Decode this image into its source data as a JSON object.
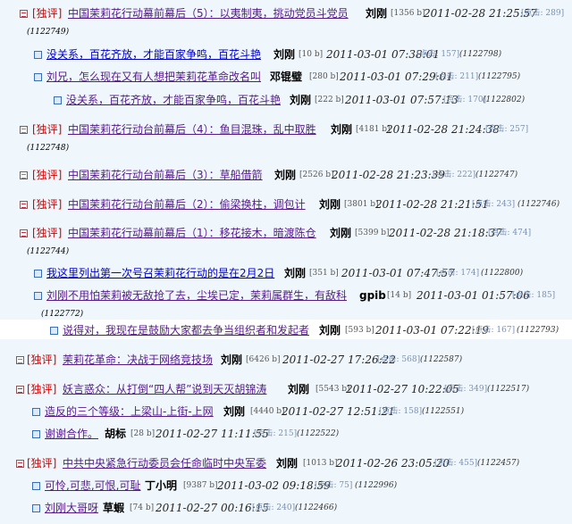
{
  "posts": [
    {
      "tag": "[独评]",
      "title": "中国茉莉花行动幕前幕后（5）：以夷制夷，挑动党员斗党员",
      "author": "刘刚",
      "size": "[1356 b]",
      "date": "2011-02-28 21:25:57",
      "clicks": "[点击: 289]",
      "id": "(1122749)"
    },
    {
      "title": "没关系，百花齐放，才能百家争鸣，百花斗艳",
      "author": "刘刚",
      "size": "[10 b]",
      "date": "2011-03-01 07:38:01",
      "clicks": "[点击: 157]",
      "id": "(1122798)"
    },
    {
      "title": "刘兄，怎么现在又有人想把茉莉花革命改名叫",
      "author": "邓锟璧",
      "size": "[280 b]",
      "date": "2011-03-01 07:29:01",
      "clicks": "[点击: 211]",
      "id": "(1122795)"
    },
    {
      "title": "没关系，百花齐放，才能百家争鸣，百花斗艳",
      "author": "刘刚",
      "size": "[222 b]",
      "date": "2011-03-01 07:57:13",
      "clicks": "[点击: 170]",
      "id": "(1122802)"
    },
    {
      "tag": "[独评]",
      "title": "中国茉莉花行动台前幕后（4）：鱼目混珠，乱中取胜",
      "author": "刘刚",
      "size": "[4181 b]",
      "date": "2011-02-28 21:24:38",
      "clicks": "[点击: 257]",
      "id": "(1122748)"
    },
    {
      "tag": "[独评]",
      "title": "中国茉莉花行动台前幕后（3）：草船借箭",
      "author": "刘刚",
      "size": "[2526 b]",
      "date": "2011-02-28 21:23:39",
      "clicks": "[点击: 222]",
      "id": "(1122747)"
    },
    {
      "tag": "[独评]",
      "title": "中国茉莉花行动台前幕后（2）：偷梁换柱，调包计",
      "author": "刘刚",
      "size": "[3801 b]",
      "date": "2011-02-28 21:21:51",
      "clicks": "[点击: 243]",
      "id": "(1122746)"
    },
    {
      "tag": "[独评]",
      "title": "中国茉莉花行动幕前幕后（1）：移花接木，暗渡陈仓",
      "author": "刘刚",
      "size": "[5399 b]",
      "date": "2011-02-28 21:18:37",
      "clicks": "[点击: 474]",
      "id": "(1122744)"
    },
    {
      "title": "我这里列出第一次号召茉莉花行动的是在2月2日",
      "author": "刘刚",
      "size": "[351 b]",
      "date": "2011-03-01 07:47:57",
      "clicks": "[点击: 174]",
      "id": "(1122800)"
    },
    {
      "title": "刘刚不用怕茉莉被无敌抢了去，尘埃已定，茉莉属群生，有敌科",
      "author": "gpib",
      "size": "[14 b]",
      "date": "2011-03-01 01:57:06",
      "clicks": "[点击: 185]",
      "id": "(1122772)"
    },
    {
      "title": "说得对，我现在是鼓励大家都去争当组织者和发起者",
      "author": "刘刚",
      "size": "[593 b]",
      "date": "2011-03-01 07:22:19",
      "clicks": "[点击: 167]",
      "id": "(1122793)"
    },
    {
      "tag": "[独评]",
      "title": "茉莉花革命：决战于网络竞技场",
      "author": "刘刚",
      "size": "[6426 b]",
      "date": "2011-02-27 17:26:22",
      "clicks": "[点击: 568]",
      "id": "(1122587)"
    },
    {
      "tag": "[独评]",
      "title": "妖言惑众：从打倒“四人帮”说到天灭胡锦涛",
      "author": "刘刚",
      "size": "[5543 b]",
      "date": "2011-02-27 10:22:05",
      "clicks": "[点击: 349]",
      "id": "(1122517)"
    },
    {
      "title": "造反的三个等级：上梁山-上街-上网",
      "author": "刘刚",
      "size": "[4440 b]",
      "date": "2011-02-27 12:51:21",
      "clicks": "[点击: 158]",
      "id": "(1122551)"
    },
    {
      "title": "谢谢合作。",
      "author": "胡标",
      "size": "[28 b]",
      "date": "2011-02-27 11:11:55",
      "clicks": "[点击: 215]",
      "id": "(1122522)"
    },
    {
      "tag": "[独评]",
      "title": "中共中央紧急行动委员会任命临时中央军委",
      "author": "刘刚",
      "size": "[1013 b]",
      "date": "2011-02-26 23:05:20",
      "clicks": "[点击: 455]",
      "id": "(1122457)"
    },
    {
      "title": "可怜,可悲,可恨,可耻",
      "author": "丁小明",
      "size": "[9387 b]",
      "date": "2011-03-02 09:18:59",
      "clicks": "[点击: 75]",
      "id": "(1122996)"
    },
    {
      "title": "刘刚大哥呀",
      "author": "草蝦",
      "size": "[74 b]",
      "date": "2011-02-27 00:16:15",
      "clicks": "[点击: 240]",
      "id": "(1122466)"
    }
  ]
}
